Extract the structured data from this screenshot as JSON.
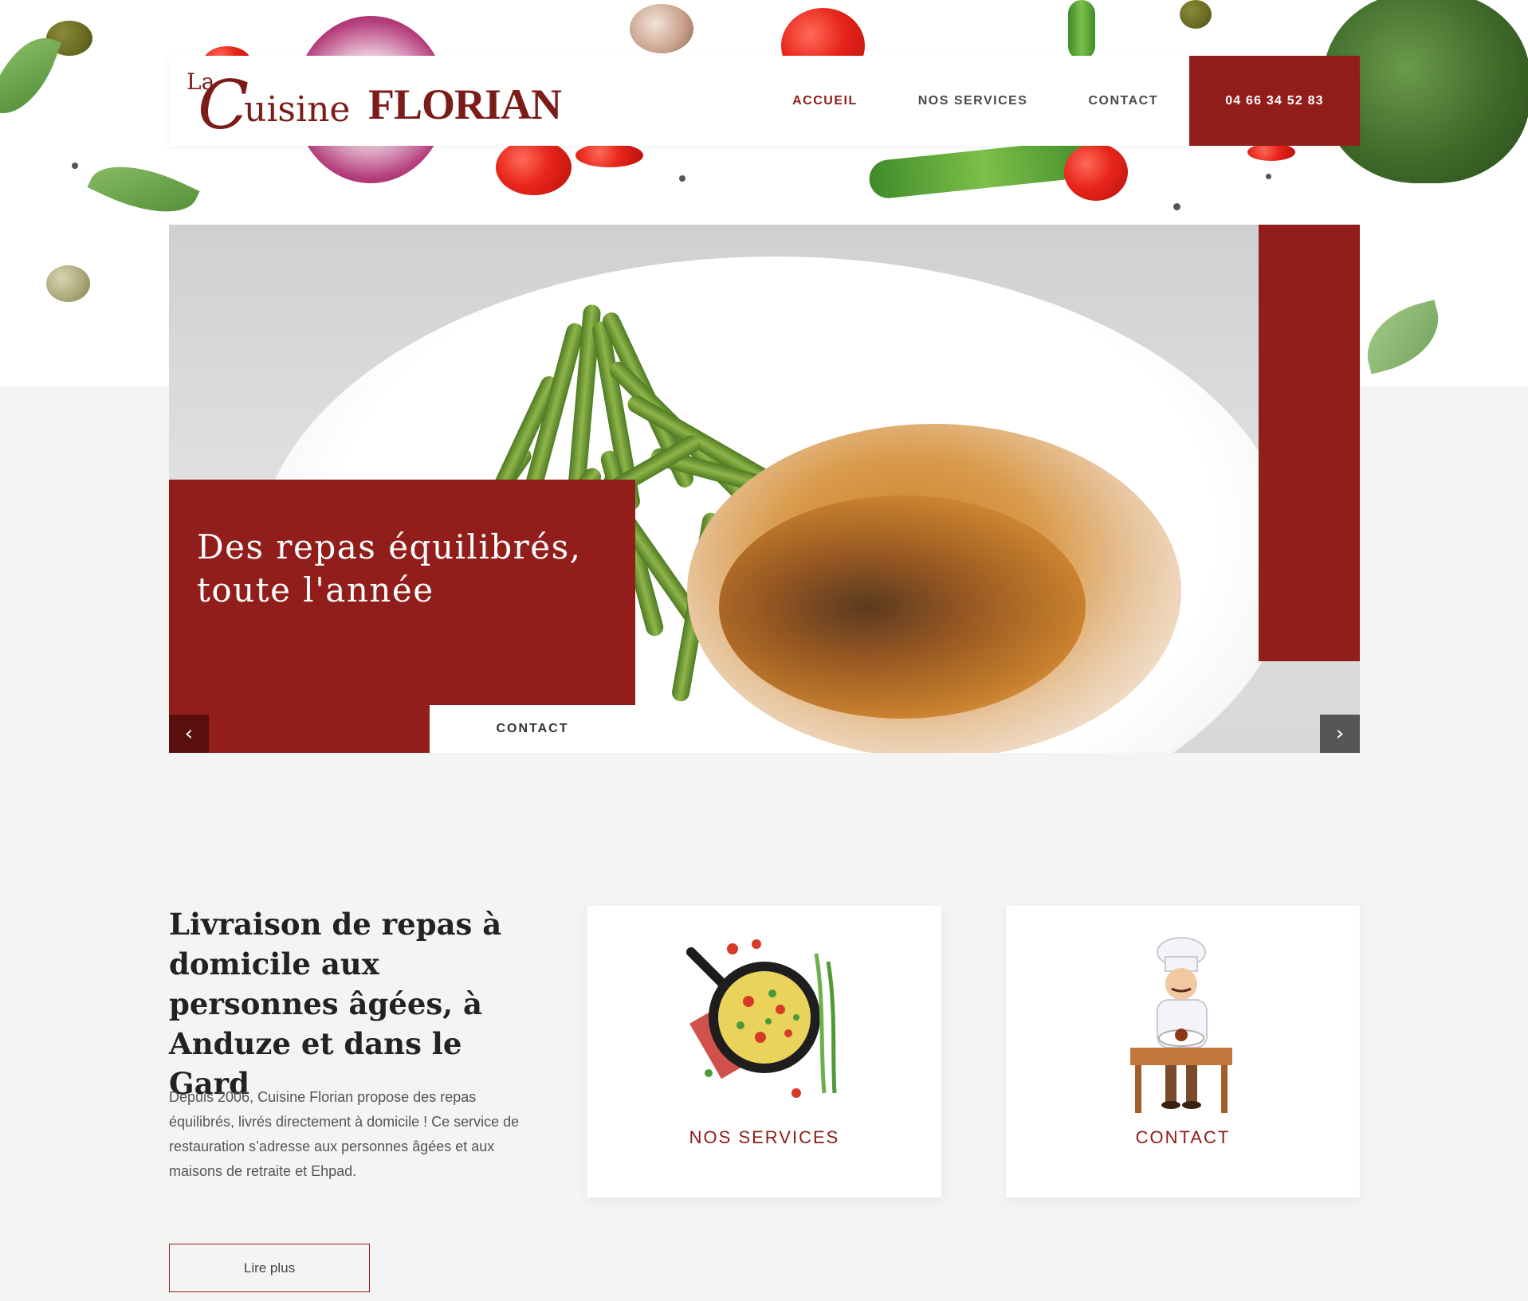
{
  "header": {
    "logo": {
      "la": "La",
      "c": "C",
      "rest": "uisine",
      "brand": "FLORIAN"
    },
    "nav": [
      {
        "label": "ACCUEIL",
        "active": true
      },
      {
        "label": "NOS SERVICES",
        "active": false
      },
      {
        "label": "CONTACT",
        "active": false
      }
    ],
    "phone": "04 66 34 52 83"
  },
  "hero": {
    "caption": "Des repas équilibrés, toute l'année",
    "contact_button": "CONTACT",
    "prev_icon": "chevron-left-icon",
    "next_icon": "chevron-right-icon",
    "prev_glyph": "‹",
    "next_glyph": "›"
  },
  "intro": {
    "title": "Livraison de repas à domicile aux personnes âgées, à Anduze et dans le Gard",
    "text": "Depuis 2006, Cuisine Florian propose des repas équilibrés, livrés directement à domicile ! Ce service de restauration s’adresse aux personnes âgées et aux maisons de retraite et Ehpad.",
    "read_more": "Lire plus"
  },
  "cards": [
    {
      "label": "NOS SERVICES",
      "illustration": "frying-pan-omelette-illustration"
    },
    {
      "label": "CONTACT",
      "illustration": "chef-at-table-illustration"
    }
  ],
  "colors": {
    "brand_red": "#921e1b",
    "dark_red": "#5a0f0d",
    "logo_red": "#7b1c18",
    "page_bg": "#f4f4f4"
  }
}
